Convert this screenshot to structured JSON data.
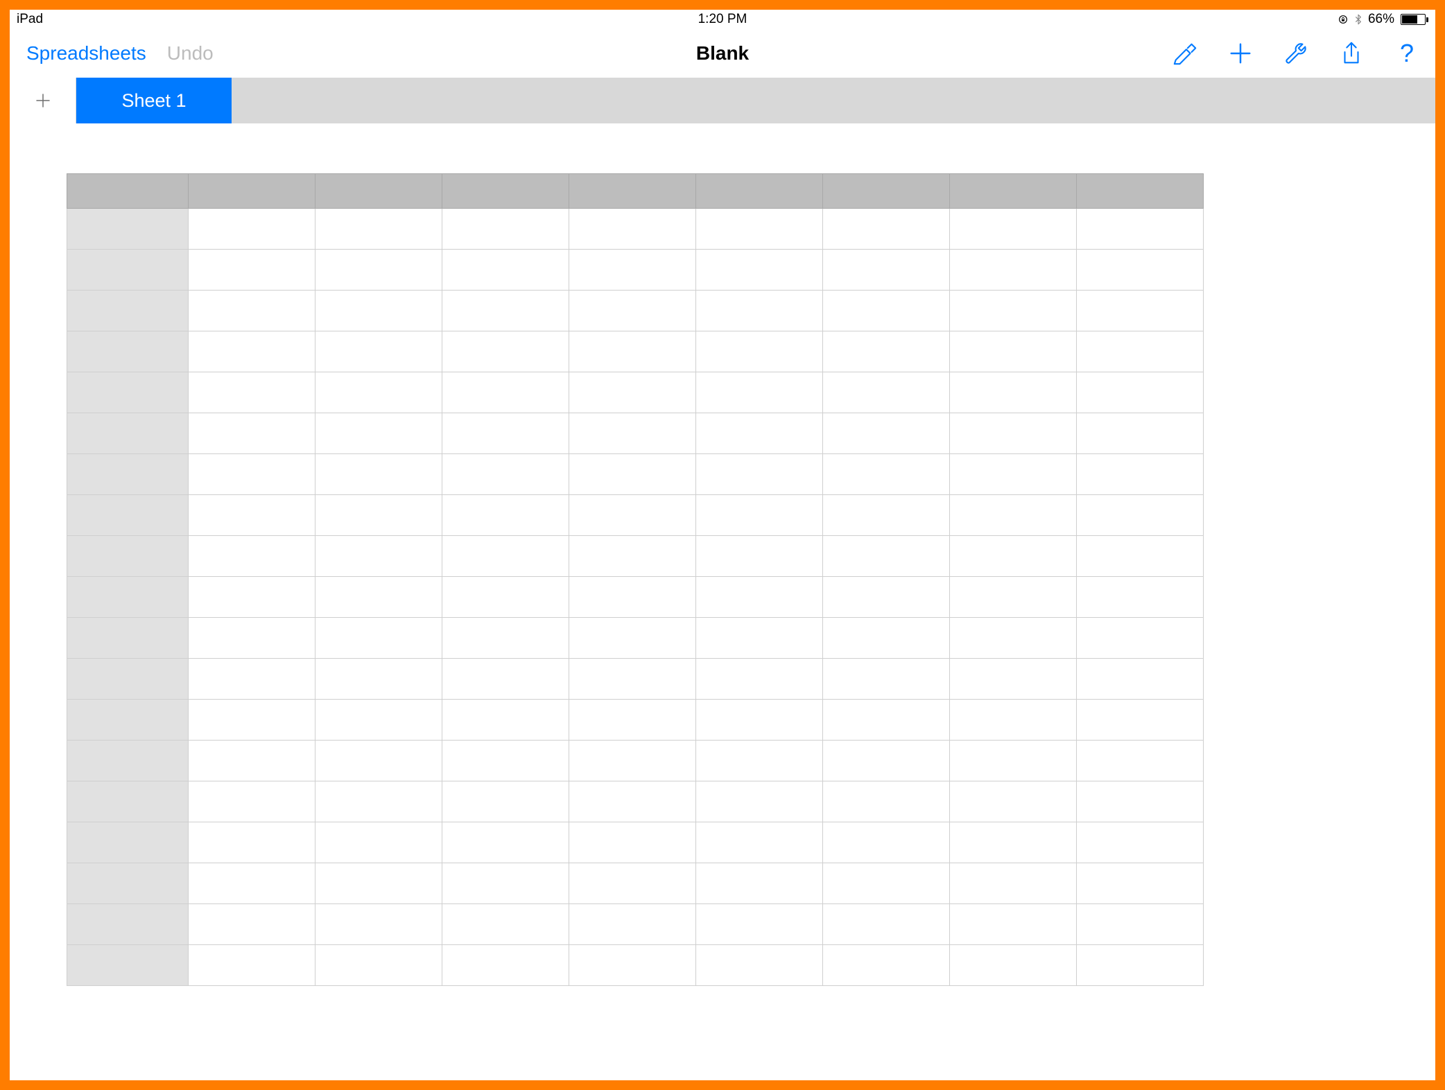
{
  "status": {
    "device": "iPad",
    "time": "1:20 PM",
    "battery_percent": "66%"
  },
  "toolbar": {
    "back_label": "Spreadsheets",
    "undo_label": "Undo",
    "title": "Blank",
    "help_label": "?"
  },
  "tabs": {
    "active_sheet_label": "Sheet 1"
  },
  "grid": {
    "columns": 8,
    "rows": 19
  },
  "colors": {
    "accent": "#007aff",
    "frame": "#ff7d00",
    "tab_bar": "#d8d8d8",
    "col_header": "#bdbdbd",
    "row_header": "#e1e1e1"
  }
}
